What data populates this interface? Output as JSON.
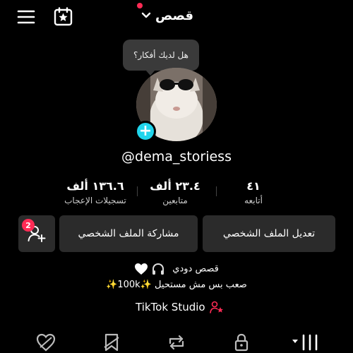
{
  "header": {
    "title": "قصص",
    "menu_icon": "hamburger-menu-icon",
    "calendar_icon": "calendar-star-icon",
    "dropdown_icon": "chevron-down-icon",
    "notification_dot_color": "#ff2b55"
  },
  "bubble": {
    "text": "هل لديك أفكار؟"
  },
  "profile": {
    "username": "@dema_storiess",
    "add_avatar_symbol": "+",
    "add_avatar_color": "#20d5ec"
  },
  "stats": {
    "following": {
      "value": "٤١",
      "label": "أتابعه"
    },
    "followers": {
      "value": "٢٣.٤ ألف",
      "label": "متابعين"
    },
    "likes": {
      "value": "١٣٦.٦ ألف",
      "label": "تسجيلات الإعجاب"
    }
  },
  "buttons": {
    "edit_profile": "تعديل الملف الشخصي",
    "share_profile": "مشاركة الملف الشخصي",
    "add_friends_badge": "2"
  },
  "bio": {
    "line1": "قصص دودي",
    "line2": "صعب بس مش مستحيل ✨100k✨"
  },
  "studio": {
    "label": "TikTok Studio"
  },
  "tabs": [
    "videos",
    "private",
    "reposts",
    "favorites",
    "liked"
  ]
}
